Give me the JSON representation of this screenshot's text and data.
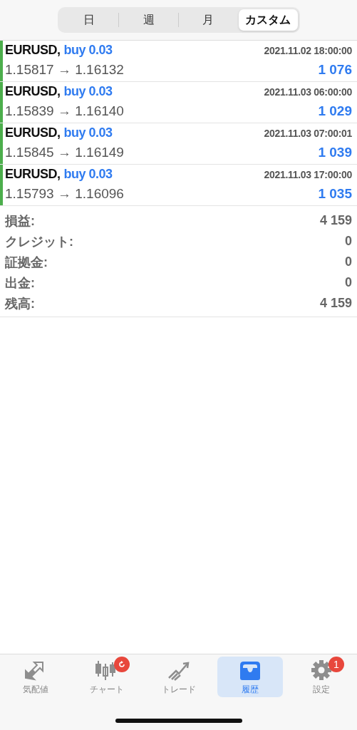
{
  "segments": [
    {
      "label": "日",
      "selected": false
    },
    {
      "label": "週",
      "selected": false
    },
    {
      "label": "月",
      "selected": false
    },
    {
      "label": "カスタム",
      "selected": true
    }
  ],
  "trades": [
    {
      "symbol": "EURUSD,",
      "kind": "buy",
      "order": "buy 0.03",
      "time": "2021.11.02 18:00:00",
      "prices": "1.15817 → 1.16132",
      "profit": "1 076"
    },
    {
      "symbol": "EURUSD,",
      "kind": "buy",
      "order": "buy 0.03",
      "time": "2021.11.03 06:00:00",
      "prices": "1.15839 → 1.16140",
      "profit": "1 029"
    },
    {
      "symbol": "EURUSD,",
      "kind": "buy",
      "order": "buy 0.03",
      "time": "2021.11.03 07:00:01",
      "prices": "1.15845 → 1.16149",
      "profit": "1 039"
    },
    {
      "symbol": "EURUSD,",
      "kind": "buy",
      "order": "buy 0.03",
      "time": "2021.11.03 17:00:00",
      "prices": "1.15793 → 1.16096",
      "profit": "1 035"
    }
  ],
  "summary": [
    {
      "label": "損益:",
      "value": "4 159"
    },
    {
      "label": "クレジット:",
      "value": "0"
    },
    {
      "label": "証拠金:",
      "value": "0"
    },
    {
      "label": "出金:",
      "value": "0"
    },
    {
      "label": "残高:",
      "value": "4 159"
    }
  ],
  "tab_bar": [
    {
      "label": "気配値",
      "selected": false
    },
    {
      "label": "チャート",
      "selected": false,
      "badge": {
        "kind": "refresh"
      }
    },
    {
      "label": "トレード",
      "selected": false
    },
    {
      "label": "履歴",
      "selected": true
    },
    {
      "label": "設定",
      "selected": false,
      "badge": {
        "kind": "count",
        "text": "1"
      }
    }
  ]
}
